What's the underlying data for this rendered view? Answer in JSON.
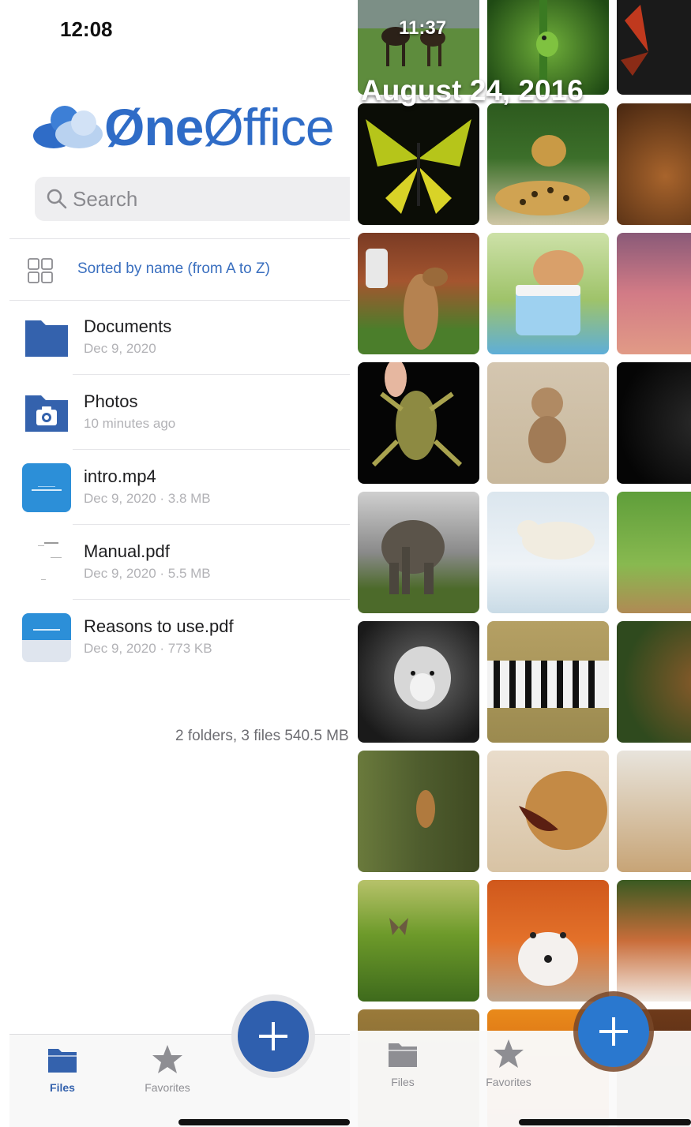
{
  "left_screen": {
    "status_time": "12:08",
    "app_name_bold": "Øne",
    "app_name_thin": "Øffice",
    "search": {
      "placeholder": "Search"
    },
    "sort_label": "Sorted by name (from A to Z)",
    "items": [
      {
        "name": "Documents",
        "meta": "Dec 9, 2020",
        "icon": "folder-icon"
      },
      {
        "name": "Photos",
        "meta": "10 minutes ago",
        "icon": "camera-folder-icon"
      },
      {
        "name": "intro.mp4",
        "meta": "Dec 9, 2020 · 3.8 MB",
        "icon": "video-thumbnail-icon"
      },
      {
        "name": "Manual.pdf",
        "meta": "Dec 9, 2020 · 5.5 MB",
        "icon": "pdf-thumbnail-icon"
      },
      {
        "name": "Reasons to use.pdf",
        "meta": "Dec 9, 2020 · 773 KB",
        "icon": "pdf-thumbnail-icon"
      }
    ],
    "summary": "2 folders, 3 files 540.5 MB",
    "tabs": {
      "files": "Files",
      "favorites": "Favorites"
    }
  },
  "right_screen": {
    "status_time": "11:37",
    "date_header": "August 24, 2016",
    "photos": [
      "horses",
      "frog",
      "butterfly-red",
      "butterfly-green",
      "jaguar",
      "orangutan",
      "chipmunk",
      "rabbit",
      "sunset",
      "frog-hand",
      "baby-monkey",
      "gorilla",
      "elephant",
      "polar-bear",
      "cheetah",
      "wolf",
      "zebras",
      "bear",
      "chipmunk-tree",
      "lioness",
      "tiger-cub",
      "butterfly-grass",
      "fox",
      "red-panda"
    ],
    "tabs": {
      "files": "Files",
      "favorites": "Favorites"
    }
  },
  "colors": {
    "brand_blue": "#2f6cc7",
    "fab_blue": "#2f5fae",
    "fab_blue_right": "#2a78cf",
    "link_blue": "#3a6fbf"
  }
}
